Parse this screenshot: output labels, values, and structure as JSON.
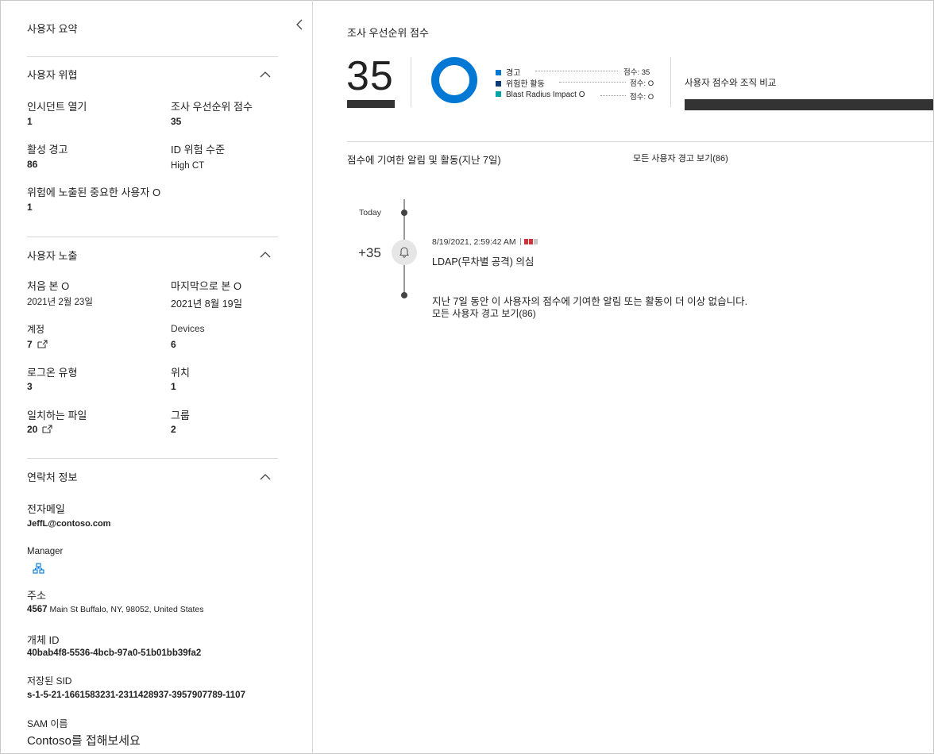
{
  "summary_header": {
    "title": "사용자 요약"
  },
  "threat": {
    "title": "사용자 위협",
    "open_incidents_label": "인시던트 열기",
    "open_incidents_value": "1",
    "priority_score_label": "조사 우선순위 점수",
    "priority_score_value": "35",
    "active_alerts_label": "활성 경고",
    "active_alerts_value": "86",
    "id_risk_label": "ID 위험 수준",
    "id_risk_value": "High CT",
    "critical_user_label": "위험에 노출된 중요한 사용자 O",
    "critical_user_value": "1"
  },
  "exposure": {
    "title": "사용자 노출",
    "first_seen_label": "처음 본 O",
    "first_seen_value": "2021년 2월 23일",
    "last_seen_label": "마지막으로 본 O",
    "last_seen_value": "2021년 8월 19일",
    "accounts_label": "계정",
    "accounts_value": "7",
    "devices_label": "Devices",
    "devices_value": "6",
    "logon_types_label": "로그온 유형",
    "logon_types_value": "3",
    "locations_label": "위치",
    "locations_value": "1",
    "matching_files_label": "일치하는 파일",
    "matching_files_value": "20",
    "groups_label": "그룹",
    "groups_value": "2"
  },
  "contact": {
    "title": "연락처 정보",
    "email_label": "전자메일",
    "email_value": "JeffL@contoso.com",
    "manager_label": "Manager",
    "address_label": "주소",
    "address_number": "4567",
    "address_value": "Main St Buffalo, NY, 98052, United States",
    "object_id_label": "개체 ID",
    "object_id_value": "40bab4f8-5536-4bcb-97a0-51b01bb39fa2",
    "sid_label": "저장된 SID",
    "sid_value": "s-1-5-21-1661583231-2311428937-3957907789-1107",
    "sam_label": "SAM 이름",
    "sam_value": "Contoso를 접해보세요"
  },
  "score_panel": {
    "title": "조사 우선순위 점수",
    "score": "35",
    "legend": [
      {
        "label": "경고",
        "value": "점수: 35",
        "color": "#0078d4"
      },
      {
        "label": "위험한 활동",
        "value": "점수: O",
        "color": "#0b3a78"
      },
      {
        "label": "Blast Radius Impact O",
        "value": "점수: O",
        "color": "#00a4a6"
      }
    ],
    "compare_label": "사용자 점수와 조직 비교"
  },
  "alerts_section": {
    "title": "점수에 기여한 알림 및 활동(지난 7일)",
    "view_all_link": "모든 사용자 경고 보기(86)"
  },
  "timeline": {
    "today_label": "Today",
    "score_delta": "+35",
    "event_time": "8/19/2021, 2:59:42 AM",
    "event_title": "LDAP(무차별 공격) 의심",
    "no_more_text": "지난 7일 동안 이 사용자의 점수에 기여한 알림 또는 활동이 더 이상 없습니다.",
    "view_all_link": "모든 사용자 경고 보기(86)"
  },
  "colors": {
    "donut": "#0078d4",
    "severity_high": "#d13438",
    "severity_low": "#c8c8c8"
  }
}
